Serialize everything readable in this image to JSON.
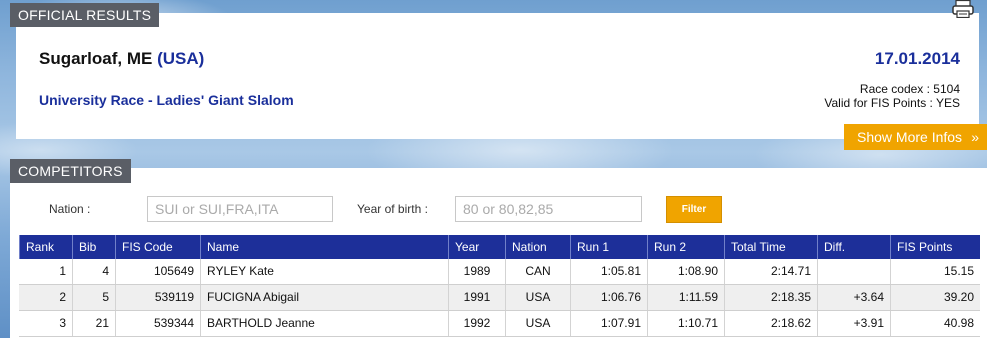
{
  "sections": {
    "official": "OFFICIAL RESULTS",
    "competitors": "COMPETITORS"
  },
  "race": {
    "place": "Sugarloaf, ME",
    "country": "(USA)",
    "date": "17.01.2014",
    "event": "University Race - Ladies' Giant Slalom",
    "codex": "Race codex : 5104",
    "fis_valid": "Valid for FIS Points : YES"
  },
  "show_more": {
    "label": "Show More Infos",
    "arrow": "»"
  },
  "filter": {
    "nation_label": "Nation :",
    "nation_placeholder": "SUI or SUI,FRA,ITA",
    "yob_label": "Year of birth :",
    "yob_placeholder": "80 or 80,82,85",
    "button": "Filter"
  },
  "table": {
    "headers": [
      "Rank",
      "Bib",
      "FIS Code",
      "Name",
      "Year",
      "Nation",
      "Run 1",
      "Run 2",
      "Total Time",
      "Diff.",
      "FIS Points"
    ],
    "rows": [
      [
        "1",
        "4",
        "105649",
        "RYLEY Kate",
        "1989",
        "CAN",
        "1:05.81",
        "1:08.90",
        "2:14.71",
        "",
        "15.15"
      ],
      [
        "2",
        "5",
        "539119",
        "FUCIGNA Abigail",
        "1991",
        "USA",
        "1:06.76",
        "1:11.59",
        "2:18.35",
        "+3.64",
        "39.20"
      ],
      [
        "3",
        "21",
        "539344",
        "BARTHOLD Jeanne",
        "1992",
        "USA",
        "1:07.91",
        "1:10.71",
        "2:18.62",
        "+3.91",
        "40.98"
      ]
    ]
  },
  "icons": {
    "print": "printer-icon"
  },
  "colors": {
    "accent": "#f0a400",
    "header_blue": "#1d2f99",
    "tab_gray": "#5a5e66"
  }
}
